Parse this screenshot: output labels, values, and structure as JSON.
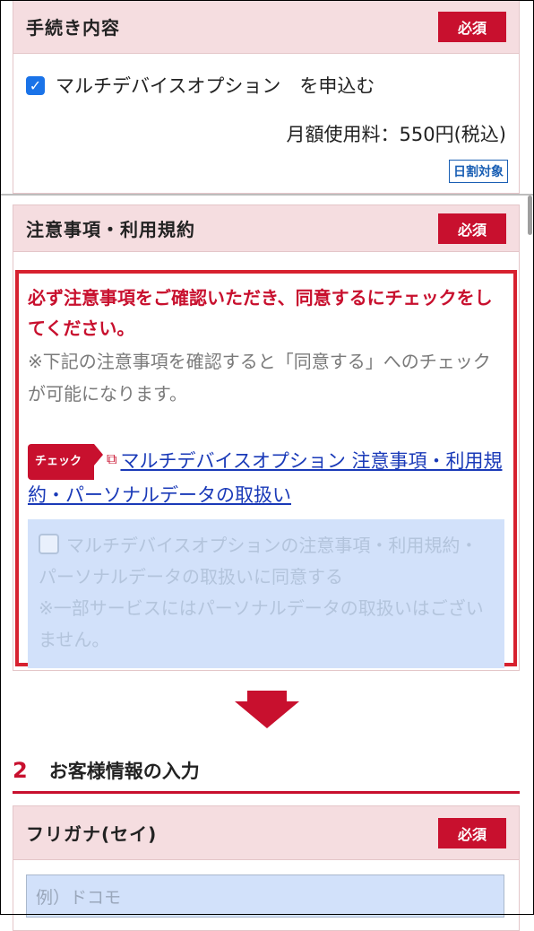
{
  "section1": {
    "title": "手続き内容",
    "required": "必須",
    "option_label": "マルチデバイスオプション　を申込む",
    "fee": "月額使用料：550円(税込)",
    "badge": "日割対象"
  },
  "section2": {
    "title": "注意事項・利用規約",
    "required": "必須",
    "warning": "必ず注意事項をご確認いただき、同意するにチェックをしてください。",
    "note": "※下記の注意事項を確認すると「同意する」へのチェックが可能になります。",
    "tag": "チェック",
    "link": "マルチデバイスオプション 注意事項・利用規約・パーソナルデータの取扱い",
    "agree_label": "マルチデバイスオプションの注意事項・利用規約・パーソナルデータの取扱いに同意する",
    "agree_note": "※一部サービスにはパーソナルデータの取扱いはございません。"
  },
  "step": {
    "number": "2",
    "title": "お客様情報の入力"
  },
  "section3": {
    "title": "フリガナ(セイ)",
    "required": "必須",
    "placeholder": "例）ドコモ"
  },
  "colors": {
    "accent": "#c8102e",
    "header_bg": "#f5dde0",
    "link": "#1a3ab8",
    "disabled_bg": "#d2e1fa"
  }
}
